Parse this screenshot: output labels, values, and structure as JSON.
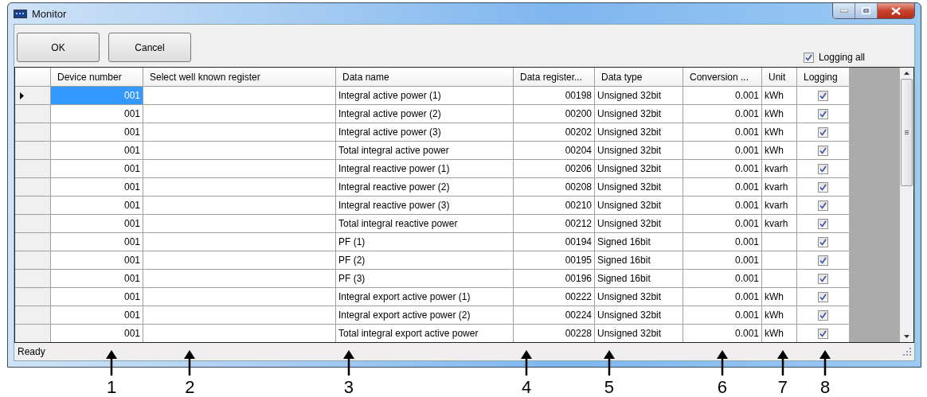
{
  "window": {
    "title": "Monitor"
  },
  "buttons": [
    {
      "label": "OK"
    },
    {
      "label": "Cancel"
    }
  ],
  "logging_all": {
    "label": "Logging all",
    "checked": true
  },
  "table": {
    "columns": [
      "Device number",
      "Select well known register",
      "Data name",
      "Data register...",
      "Data type",
      "Conversion ...",
      "Unit",
      "Logging"
    ],
    "rows": [
      {
        "selected": true,
        "device": "001",
        "data_name": "Integral active power (1)",
        "register": "00198",
        "type": "Unsigned 32bit",
        "conversion": "0.001",
        "unit": "kWh",
        "logging": true
      },
      {
        "selected": false,
        "device": "001",
        "data_name": "Integral active power (2)",
        "register": "00200",
        "type": "Unsigned 32bit",
        "conversion": "0.001",
        "unit": "kWh",
        "logging": true
      },
      {
        "selected": false,
        "device": "001",
        "data_name": "Integral active power (3)",
        "register": "00202",
        "type": "Unsigned 32bit",
        "conversion": "0.001",
        "unit": "kWh",
        "logging": true
      },
      {
        "selected": false,
        "device": "001",
        "data_name": "Total integral active power",
        "register": "00204",
        "type": "Unsigned 32bit",
        "conversion": "0.001",
        "unit": "kWh",
        "logging": true
      },
      {
        "selected": false,
        "device": "001",
        "data_name": "Integral reactive power (1)",
        "register": "00206",
        "type": "Unsigned 32bit",
        "conversion": "0.001",
        "unit": "kvarh",
        "logging": true
      },
      {
        "selected": false,
        "device": "001",
        "data_name": "Integral reactive power (2)",
        "register": "00208",
        "type": "Unsigned 32bit",
        "conversion": "0.001",
        "unit": "kvarh",
        "logging": true
      },
      {
        "selected": false,
        "device": "001",
        "data_name": "Integral reactive power (3)",
        "register": "00210",
        "type": "Unsigned 32bit",
        "conversion": "0.001",
        "unit": "kvarh",
        "logging": true
      },
      {
        "selected": false,
        "device": "001",
        "data_name": "Total integral reactive power",
        "register": "00212",
        "type": "Unsigned 32bit",
        "conversion": "0.001",
        "unit": "kvarh",
        "logging": true
      },
      {
        "selected": false,
        "device": "001",
        "data_name": "PF (1)",
        "register": "00194",
        "type": "Signed 16bit",
        "conversion": "0.001",
        "logging": true
      },
      {
        "selected": false,
        "device": "001",
        "data_name": "PF (2)",
        "register": "00195",
        "type": "Signed 16bit",
        "conversion": "0.001",
        "logging": true
      },
      {
        "selected": false,
        "device": "001",
        "data_name": "PF (3)",
        "register": "00196",
        "type": "Signed 16bit",
        "conversion": "0.001",
        "logging": true
      },
      {
        "selected": false,
        "device": "001",
        "data_name": "Integral export active power (1)",
        "register": "00222",
        "type": "Unsigned 32bit",
        "conversion": "0.001",
        "unit": "kWh",
        "logging": true
      },
      {
        "selected": false,
        "device": "001",
        "data_name": "Integral export active power (2)",
        "register": "00224",
        "type": "Unsigned 32bit",
        "conversion": "0.001",
        "unit": "kWh",
        "logging": true
      },
      {
        "selected": false,
        "device": "001",
        "data_name": "Total integral export active power",
        "register": "00228",
        "type": "Unsigned 32bit",
        "conversion": "0.001",
        "unit": "kWh",
        "logging": true
      }
    ]
  },
  "status_bar": {
    "text": "Ready"
  },
  "callouts": [
    {
      "label": "1"
    },
    {
      "label": "2"
    },
    {
      "label": "3"
    },
    {
      "label": "4"
    },
    {
      "label": "5"
    },
    {
      "label": "6"
    },
    {
      "label": "7"
    },
    {
      "label": "8"
    }
  ]
}
